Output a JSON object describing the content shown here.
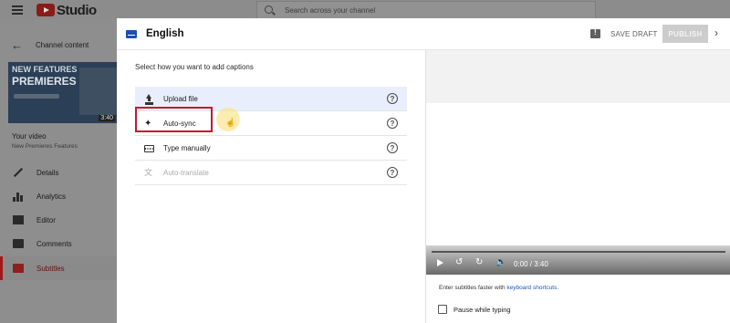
{
  "studio": {
    "logo_text": "Studio",
    "search_placeholder": "Search across your channel",
    "sidebar": {
      "back_label": "Channel content",
      "thumbnail": {
        "line1": "NEW FEATURES",
        "line2": "PREMIERES",
        "duration": "3:40"
      },
      "your_video": "Your video",
      "video_title": "New Premieres Features",
      "items": [
        {
          "label": "Details",
          "icon": "pencil-icon"
        },
        {
          "label": "Analytics",
          "icon": "analytics-icon"
        },
        {
          "label": "Editor",
          "icon": "film-icon"
        },
        {
          "label": "Comments",
          "icon": "comments-icon"
        },
        {
          "label": "Subtitles",
          "icon": "subtitles-icon",
          "active": true
        }
      ]
    }
  },
  "dialog": {
    "title": "English",
    "save_draft": "SAVE DRAFT",
    "publish": "PUBLISH",
    "prompt": "Select how you want to add captions",
    "options": [
      {
        "label": "Upload file",
        "icon": "upload-icon",
        "highlighted": true
      },
      {
        "label": "Auto-sync",
        "icon": "sparkle-icon"
      },
      {
        "label": "Type manually",
        "icon": "keyboard-icon"
      },
      {
        "label": "Auto-translate",
        "icon": "translate-icon",
        "disabled": true
      }
    ],
    "help_glyph": "?",
    "player": {
      "time": "0:00 / 3:40"
    },
    "shortcut_tip_prefix": "Enter subtitles faster with ",
    "shortcut_tip_link": "keyboard shortcuts",
    "shortcut_tip_suffix": ".",
    "pause_label": "Pause while typing",
    "colors": {
      "accent_blue": "#1a4fb4",
      "highlight_red": "#c01c2e",
      "subtitles_red": "#8e1f1f"
    }
  }
}
